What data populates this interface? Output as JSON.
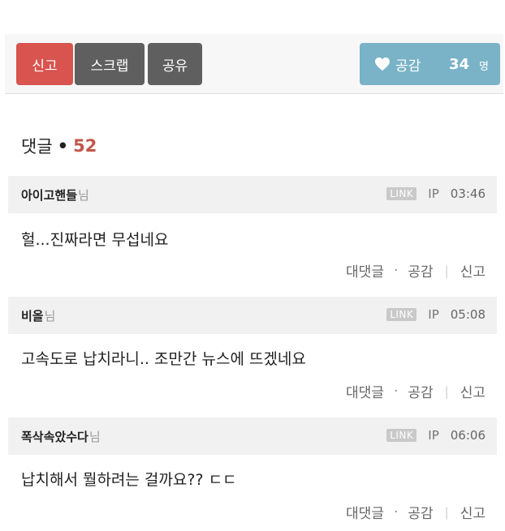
{
  "toolbar": {
    "report_label": "신고",
    "scrap_label": "스크랩",
    "share_label": "공유",
    "like_label": "공감",
    "like_count": "34",
    "like_unit": "명"
  },
  "comments_header": {
    "title": "댓글",
    "separator": "•",
    "count": "52"
  },
  "comments": [
    {
      "author": "아이고핸들",
      "author_suffix": "님",
      "link": "LINK",
      "ip": "IP",
      "time": "03:46",
      "text": "헐...진짜라면 무섭네요",
      "reply": "대댓글",
      "like": "공감",
      "report": "신고"
    },
    {
      "author": "비올",
      "author_suffix": "님",
      "link": "LINK",
      "ip": "IP",
      "time": "05:08",
      "text": "고속도로 납치라니.. 조만간 뉴스에 뜨겠네요",
      "reply": "대댓글",
      "like": "공감",
      "report": "신고"
    },
    {
      "author": "폭삭속았수다",
      "author_suffix": "님",
      "link": "LINK",
      "ip": "IP",
      "time": "06:06",
      "text": "납치해서 뭘하려는 걸까요?? ㄷㄷ",
      "reply": "대댓글",
      "like": "공감",
      "report": "신고"
    }
  ],
  "colors": {
    "report": "#d9534f",
    "neutral_button": "#5f5f5f",
    "like_button": "#7ab3c7",
    "comment_count": "#c0574a"
  }
}
